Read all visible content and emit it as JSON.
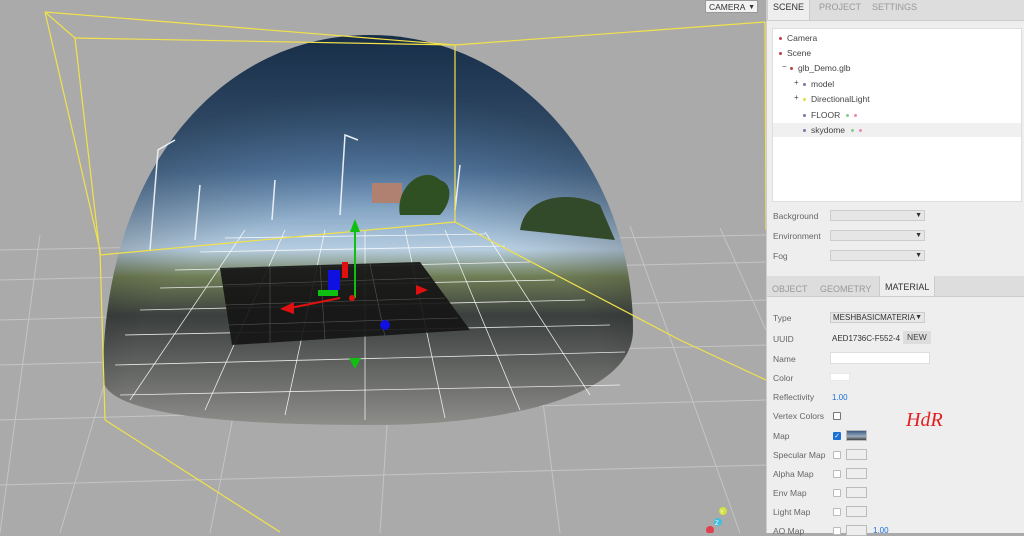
{
  "viewport": {
    "camera_select": "CAMERA",
    "annotation_text": "HdR",
    "colors": {
      "bbox": "#f2e24a",
      "annotation": "#e02020",
      "grid": "#c8c8c8",
      "floor": "#1a1a1a"
    },
    "axes": {
      "x": "X",
      "y": "Y",
      "z": "Z"
    }
  },
  "sidebar": {
    "tabs": [
      "SCENE",
      "PROJECT",
      "SETTINGS"
    ],
    "outliner": {
      "items": [
        {
          "label": "Camera",
          "dot": "#b44"
        },
        {
          "label": "Scene",
          "dot": "#b44"
        },
        {
          "label": "glb_Demo.glb",
          "dot": "#b44",
          "expander": "−"
        },
        {
          "label": "model",
          "dot": "#77a",
          "expander": "+"
        },
        {
          "label": "DirectionalLight",
          "dot": "#dd4",
          "expander": "+"
        },
        {
          "label": "FLOOR",
          "dot": "#77a"
        },
        {
          "label": "skydome",
          "dot": "#77a"
        }
      ]
    },
    "scene_props": {
      "background": "Background",
      "environment": "Environment",
      "fog": "Fog"
    },
    "object_tabs": [
      "OBJECT",
      "GEOMETRY",
      "MATERIAL"
    ],
    "material": {
      "type_label": "Type",
      "type_value": "MESHBASICMATERIA",
      "uuid_label": "UUID",
      "uuid_value": "AED1736C-F552-4",
      "new_button": "NEW",
      "name_label": "Name",
      "color_label": "Color",
      "reflectivity_label": "Reflectivity",
      "reflectivity_value": "1.00",
      "vertex_colors_label": "Vertex Colors",
      "map_label": "Map",
      "specular_map_label": "Specular Map",
      "alpha_map_label": "Alpha Map",
      "env_map_label": "Env Map",
      "light_map_label": "Light Map",
      "ao_map_label": "AO Map",
      "ao_value": "1.00"
    }
  }
}
